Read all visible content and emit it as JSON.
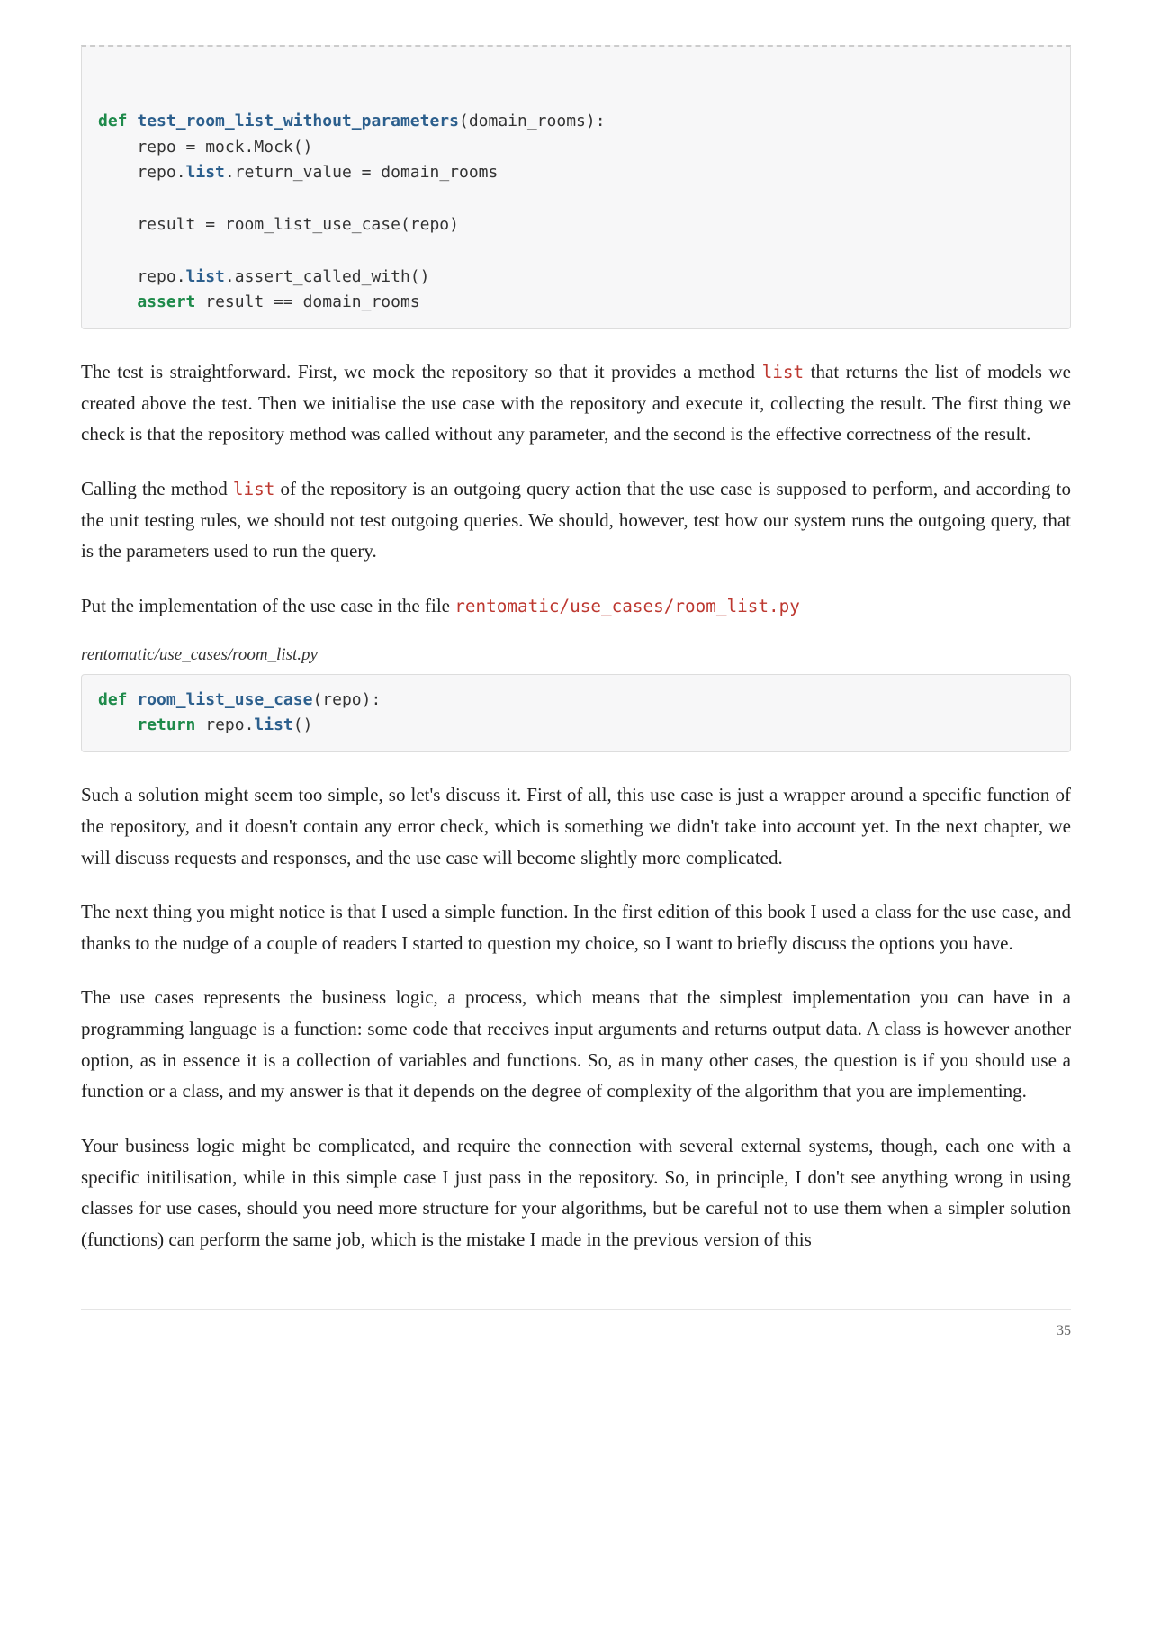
{
  "code1": {
    "line1_kw": "def",
    "line1_fn": "test_room_list_without_parameters",
    "line1_rest": "(domain_rooms):",
    "line2": "    repo = mock.Mock()",
    "line3a": "    repo.",
    "line3b": "list",
    "line3c": ".return_value = domain_rooms",
    "line4": "",
    "line5": "    result = room_list_use_case(repo)",
    "line6": "",
    "line7a": "    repo.",
    "line7b": "list",
    "line7c": ".assert_called_with()",
    "line8_indent": "    ",
    "line8_kw": "assert",
    "line8_rest": " result == domain_rooms"
  },
  "p1_a": "The test is straightforward. First, we mock the repository so that it provides a method ",
  "p1_code": "list",
  "p1_b": " that returns the list of models we created above the test. Then we initialise the use case with the repository and execute it, collecting the result. The first thing we check is that the repository method was called without any parameter, and the second is the effective correctness of the result.",
  "p2_a": "Calling the method ",
  "p2_code": "list",
  "p2_b": " of the repository is an outgoing query action that the use case is supposed to perform, and according to the unit testing rules, we should not test outgoing queries. We should, however, test how our system runs the outgoing query, that is the parameters used to run the query.",
  "p3_a": "Put the implementation of the use case in the file ",
  "p3_code": "rentomatic/use_cases/room_list.py",
  "filename": "rentomatic/use_cases/room_list.py",
  "code2": {
    "line1_kw": "def",
    "line1_fn": "room_list_use_case",
    "line1_rest": "(repo):",
    "line2_indent": "    ",
    "line2_kw": "return",
    "line2_a": " repo.",
    "line2_b": "list",
    "line2_c": "()"
  },
  "p4": "Such a solution might seem too simple, so let's discuss it. First of all, this use case is just a wrapper around a specific function of the repository, and it doesn't contain any error check, which is something we didn't take into account yet. In the next chapter, we will discuss requests and responses, and the use case will become slightly more complicated.",
  "p5": "The next thing you might notice is that I used a simple function. In the first edition of this book I used a class for the use case, and thanks to the nudge of a couple of readers I started to question my choice, so I want to briefly discuss the options you have.",
  "p6": "The use cases represents the business logic, a process, which means that the simplest implementation you can have in a programming language is a function: some code that receives input arguments and returns output data. A class is however another option, as in essence it is a collection of variables and functions. So, as in many other cases, the question is if you should use a function or a class, and my answer is that it depends on the degree of complexity of the algorithm that you are implementing.",
  "p7": "Your business logic might be complicated, and require the connection with several external systems, though, each one with a specific initilisation, while in this simple case I just pass in the repository. So, in principle, I don't see anything wrong in using classes for use cases, should you need more structure for your algorithms, but be careful not to use them when a simpler solution (functions) can perform the same job, which is the mistake I made in the previous version of this",
  "page_number": "35"
}
